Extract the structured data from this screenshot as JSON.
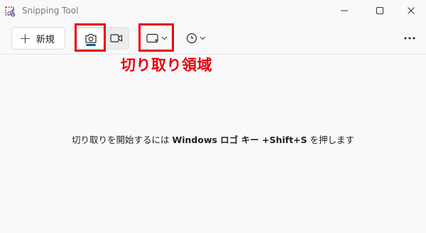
{
  "window": {
    "title": "Snipping Tool"
  },
  "toolbar": {
    "new_label": "新規",
    "new_icon": "plus-icon",
    "snip_mode_icon": "camera-icon",
    "record_mode_icon": "video-camera-icon",
    "snip_shape_icon": "rectangle-snip-icon",
    "delay_icon": "clock-icon",
    "more_icon": "more-dots-icon",
    "accent_color": "#005fb8"
  },
  "main": {
    "hint_prefix": "切り取りを開始するには ",
    "hint_keys": "Windows ロゴ キー +Shift+S",
    "hint_suffix": " を押します"
  },
  "annotation": {
    "label": "切り取り領域",
    "color": "#e8000a"
  }
}
